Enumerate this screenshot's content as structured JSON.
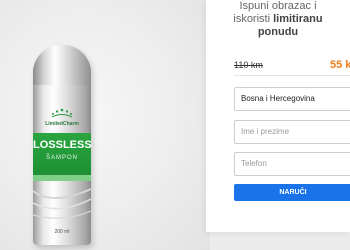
{
  "product": {
    "brand": "LimitedCharm",
    "name": "LOSSLESS",
    "subtitle": "ŠAMPON",
    "volume": "200 ml"
  },
  "promo": {
    "line1": "Ispuni obrazac i",
    "line2_plain": "iskoristi ",
    "line2_highlight": "limitiranu",
    "line3_highlight": "ponudu"
  },
  "pricing": {
    "old_price": "110 km",
    "new_price": "55 k"
  },
  "form": {
    "country_value": "Bosna i Hercegovina",
    "name_placeholder": "Ime i prezime",
    "phone_placeholder": "Telefon",
    "submit_label": "NARUČI"
  },
  "colors": {
    "accent": "#f07e1a",
    "button": "#1a73e8",
    "label_green": "#1e8f34"
  }
}
